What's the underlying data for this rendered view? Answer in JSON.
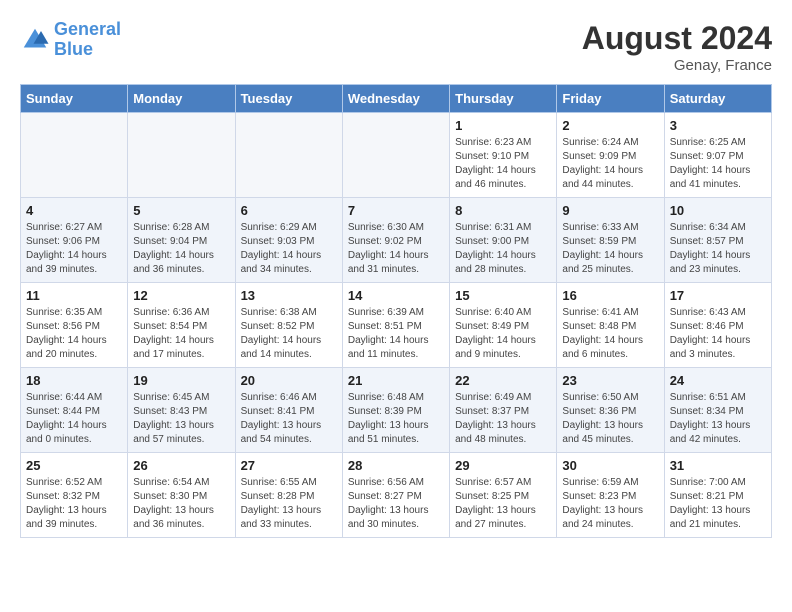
{
  "header": {
    "logo_line1": "General",
    "logo_line2": "Blue",
    "month_year": "August 2024",
    "location": "Genay, France"
  },
  "days_of_week": [
    "Sunday",
    "Monday",
    "Tuesday",
    "Wednesday",
    "Thursday",
    "Friday",
    "Saturday"
  ],
  "weeks": [
    [
      {
        "day": "",
        "info": ""
      },
      {
        "day": "",
        "info": ""
      },
      {
        "day": "",
        "info": ""
      },
      {
        "day": "",
        "info": ""
      },
      {
        "day": "1",
        "info": "Sunrise: 6:23 AM\nSunset: 9:10 PM\nDaylight: 14 hours\nand 46 minutes."
      },
      {
        "day": "2",
        "info": "Sunrise: 6:24 AM\nSunset: 9:09 PM\nDaylight: 14 hours\nand 44 minutes."
      },
      {
        "day": "3",
        "info": "Sunrise: 6:25 AM\nSunset: 9:07 PM\nDaylight: 14 hours\nand 41 minutes."
      }
    ],
    [
      {
        "day": "4",
        "info": "Sunrise: 6:27 AM\nSunset: 9:06 PM\nDaylight: 14 hours\nand 39 minutes."
      },
      {
        "day": "5",
        "info": "Sunrise: 6:28 AM\nSunset: 9:04 PM\nDaylight: 14 hours\nand 36 minutes."
      },
      {
        "day": "6",
        "info": "Sunrise: 6:29 AM\nSunset: 9:03 PM\nDaylight: 14 hours\nand 34 minutes."
      },
      {
        "day": "7",
        "info": "Sunrise: 6:30 AM\nSunset: 9:02 PM\nDaylight: 14 hours\nand 31 minutes."
      },
      {
        "day": "8",
        "info": "Sunrise: 6:31 AM\nSunset: 9:00 PM\nDaylight: 14 hours\nand 28 minutes."
      },
      {
        "day": "9",
        "info": "Sunrise: 6:33 AM\nSunset: 8:59 PM\nDaylight: 14 hours\nand 25 minutes."
      },
      {
        "day": "10",
        "info": "Sunrise: 6:34 AM\nSunset: 8:57 PM\nDaylight: 14 hours\nand 23 minutes."
      }
    ],
    [
      {
        "day": "11",
        "info": "Sunrise: 6:35 AM\nSunset: 8:56 PM\nDaylight: 14 hours\nand 20 minutes."
      },
      {
        "day": "12",
        "info": "Sunrise: 6:36 AM\nSunset: 8:54 PM\nDaylight: 14 hours\nand 17 minutes."
      },
      {
        "day": "13",
        "info": "Sunrise: 6:38 AM\nSunset: 8:52 PM\nDaylight: 14 hours\nand 14 minutes."
      },
      {
        "day": "14",
        "info": "Sunrise: 6:39 AM\nSunset: 8:51 PM\nDaylight: 14 hours\nand 11 minutes."
      },
      {
        "day": "15",
        "info": "Sunrise: 6:40 AM\nSunset: 8:49 PM\nDaylight: 14 hours\nand 9 minutes."
      },
      {
        "day": "16",
        "info": "Sunrise: 6:41 AM\nSunset: 8:48 PM\nDaylight: 14 hours\nand 6 minutes."
      },
      {
        "day": "17",
        "info": "Sunrise: 6:43 AM\nSunset: 8:46 PM\nDaylight: 14 hours\nand 3 minutes."
      }
    ],
    [
      {
        "day": "18",
        "info": "Sunrise: 6:44 AM\nSunset: 8:44 PM\nDaylight: 14 hours\nand 0 minutes."
      },
      {
        "day": "19",
        "info": "Sunrise: 6:45 AM\nSunset: 8:43 PM\nDaylight: 13 hours\nand 57 minutes."
      },
      {
        "day": "20",
        "info": "Sunrise: 6:46 AM\nSunset: 8:41 PM\nDaylight: 13 hours\nand 54 minutes."
      },
      {
        "day": "21",
        "info": "Sunrise: 6:48 AM\nSunset: 8:39 PM\nDaylight: 13 hours\nand 51 minutes."
      },
      {
        "day": "22",
        "info": "Sunrise: 6:49 AM\nSunset: 8:37 PM\nDaylight: 13 hours\nand 48 minutes."
      },
      {
        "day": "23",
        "info": "Sunrise: 6:50 AM\nSunset: 8:36 PM\nDaylight: 13 hours\nand 45 minutes."
      },
      {
        "day": "24",
        "info": "Sunrise: 6:51 AM\nSunset: 8:34 PM\nDaylight: 13 hours\nand 42 minutes."
      }
    ],
    [
      {
        "day": "25",
        "info": "Sunrise: 6:52 AM\nSunset: 8:32 PM\nDaylight: 13 hours\nand 39 minutes."
      },
      {
        "day": "26",
        "info": "Sunrise: 6:54 AM\nSunset: 8:30 PM\nDaylight: 13 hours\nand 36 minutes."
      },
      {
        "day": "27",
        "info": "Sunrise: 6:55 AM\nSunset: 8:28 PM\nDaylight: 13 hours\nand 33 minutes."
      },
      {
        "day": "28",
        "info": "Sunrise: 6:56 AM\nSunset: 8:27 PM\nDaylight: 13 hours\nand 30 minutes."
      },
      {
        "day": "29",
        "info": "Sunrise: 6:57 AM\nSunset: 8:25 PM\nDaylight: 13 hours\nand 27 minutes."
      },
      {
        "day": "30",
        "info": "Sunrise: 6:59 AM\nSunset: 8:23 PM\nDaylight: 13 hours\nand 24 minutes."
      },
      {
        "day": "31",
        "info": "Sunrise: 7:00 AM\nSunset: 8:21 PM\nDaylight: 13 hours\nand 21 minutes."
      }
    ]
  ]
}
